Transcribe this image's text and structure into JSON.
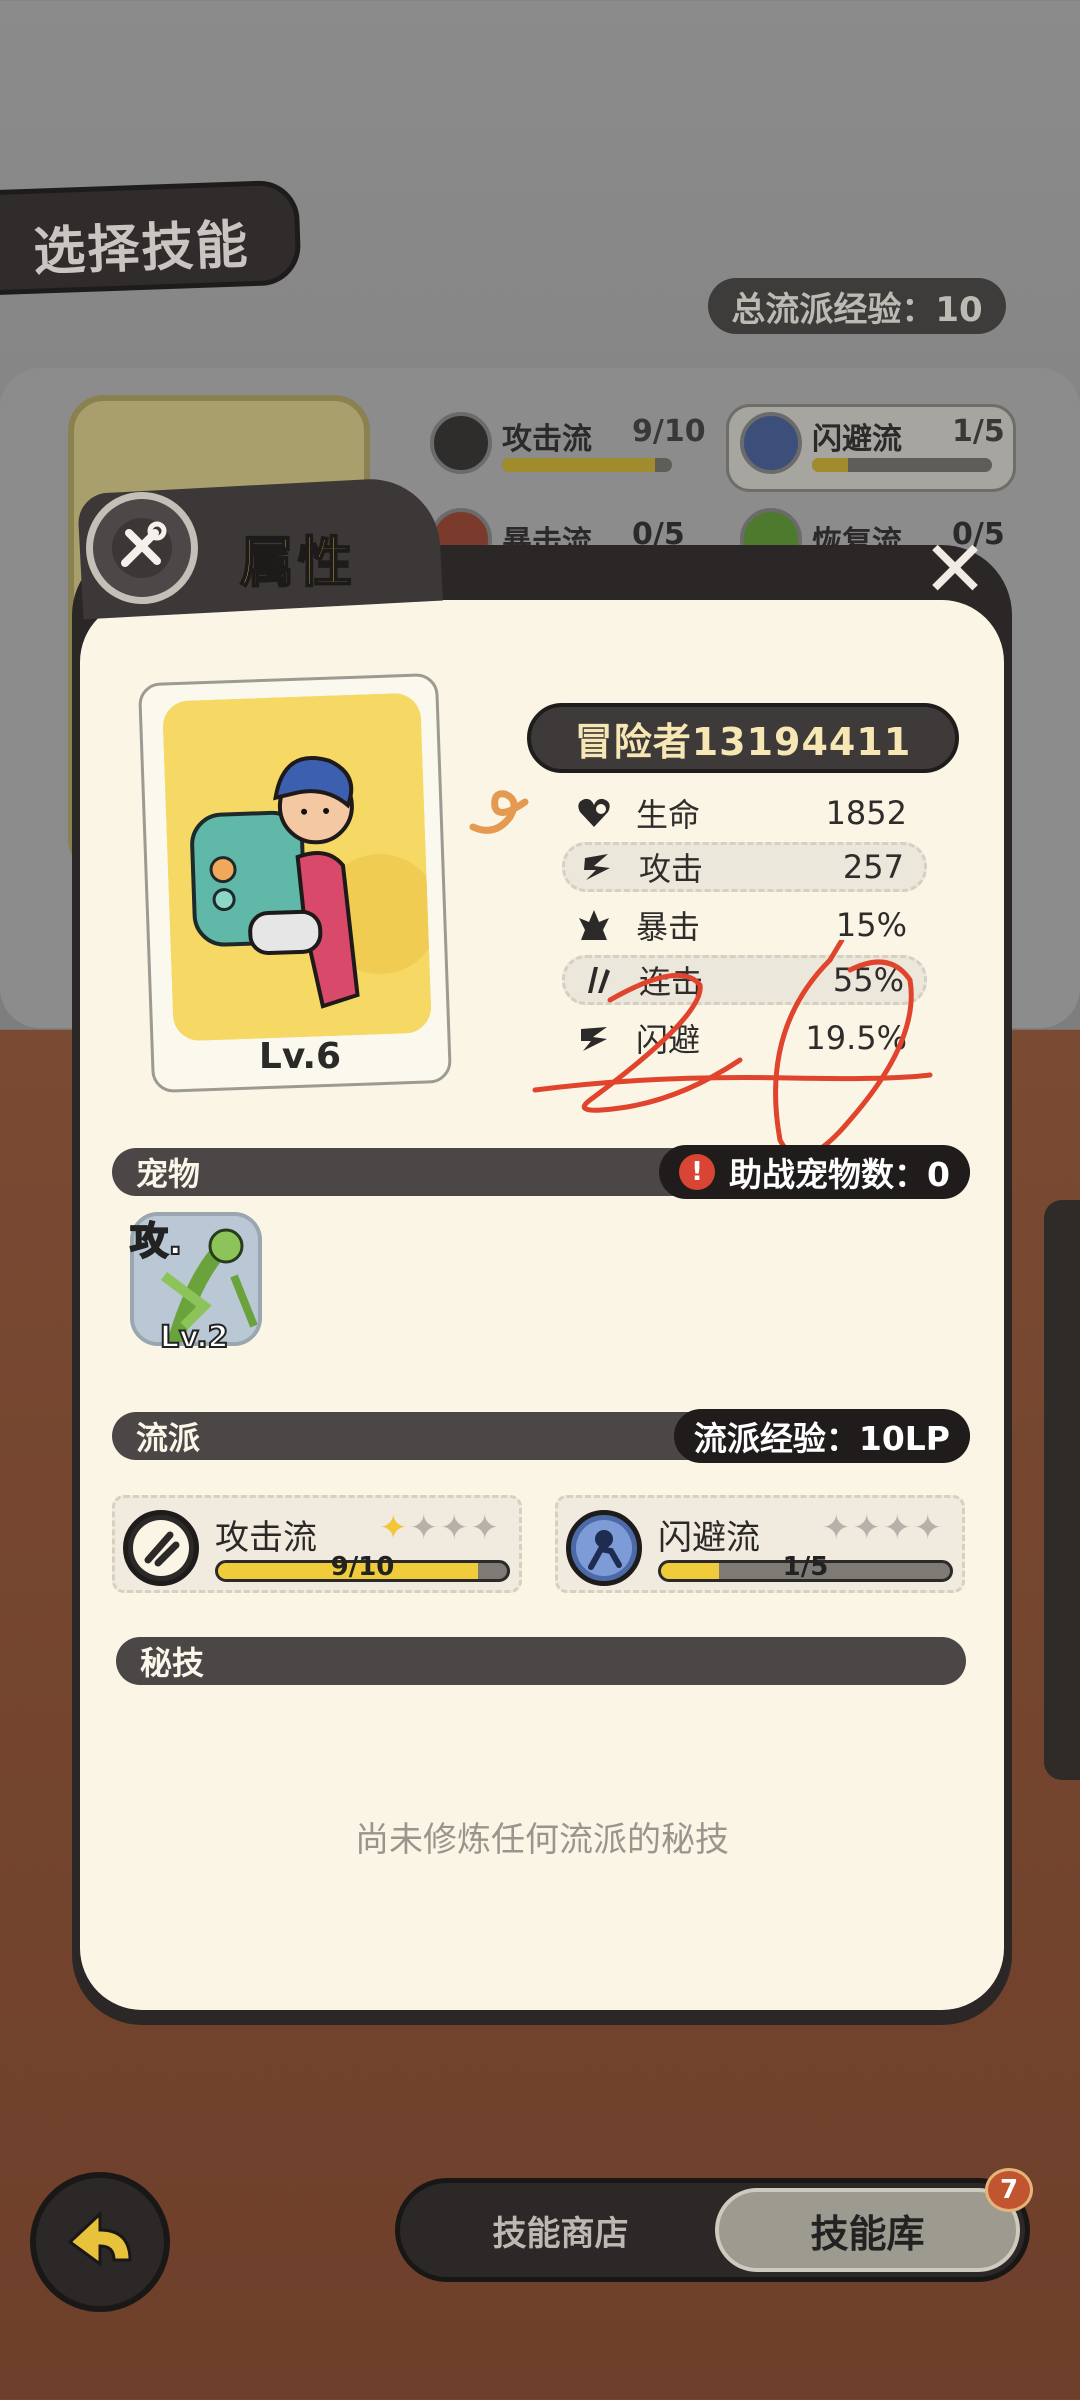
{
  "background": {
    "screen_title": "选择技能",
    "total_exp": "总流派经验：10",
    "schools": [
      {
        "name": "攻击流",
        "progress": "9/10",
        "fill": 0.9
      },
      {
        "name": "闪避流",
        "progress": "1/5",
        "fill": 0.2
      },
      {
        "name": "暴击流",
        "progress": "0/5",
        "fill": 0
      },
      {
        "name": "恢复流",
        "progress": "0/5",
        "fill": 0
      }
    ]
  },
  "modal": {
    "title": "属性",
    "close": "✕"
  },
  "character": {
    "level": "Lv.6",
    "name": "冒险者13194411"
  },
  "stats": [
    {
      "icon": "heart-icon",
      "label": "生命",
      "value": "1852"
    },
    {
      "icon": "attack-icon",
      "label": "攻击",
      "value": "257"
    },
    {
      "icon": "crit-icon",
      "label": "暴击",
      "value": "15%"
    },
    {
      "icon": "combo-icon",
      "label": "连击",
      "value": "55%"
    },
    {
      "icon": "dodge-icon",
      "label": "闪避",
      "value": "19.5%"
    }
  ],
  "pets": {
    "title": "宠物",
    "assist_count": "助战宠物数：0",
    "warn_icon": "!",
    "items": [
      {
        "tag": "攻.",
        "level": "Lv.2"
      }
    ]
  },
  "schools": {
    "title": "流派",
    "exp": "流派经验：10LP",
    "items": [
      {
        "name": "攻击流",
        "progress": "9/10",
        "fill": 0.9,
        "stars_filled": 1,
        "stars_total": 4
      },
      {
        "name": "闪避流",
        "progress": "1/5",
        "fill": 0.2,
        "stars_filled": 0,
        "stars_total": 4
      }
    ]
  },
  "secret": {
    "title": "秘技",
    "empty": "尚未修炼任何流派的秘技"
  },
  "bottom": {
    "shop_tab": "技能商店",
    "library_tab": "技能库",
    "badge": "7"
  },
  "colors": {
    "accent_yellow": "#f0cb3c",
    "modal_bg": "#fbf5e6",
    "scribble_red": "#e0442c"
  }
}
